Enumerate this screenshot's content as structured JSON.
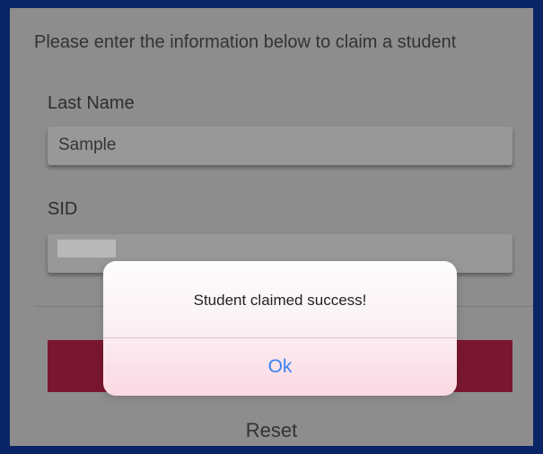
{
  "form": {
    "instructions": "Please enter the information below to claim a student",
    "last_name_label": "Last Name",
    "last_name_value": "Sample",
    "sid_label": "SID",
    "reset_label": "Reset"
  },
  "alert": {
    "message": "Student claimed success!",
    "ok_label": "Ok"
  },
  "colors": {
    "screen_border": "#0a2566",
    "overlay_dim": "#8d8d8d",
    "claim_button": "#7a1730",
    "link_blue": "#3b82f0"
  }
}
